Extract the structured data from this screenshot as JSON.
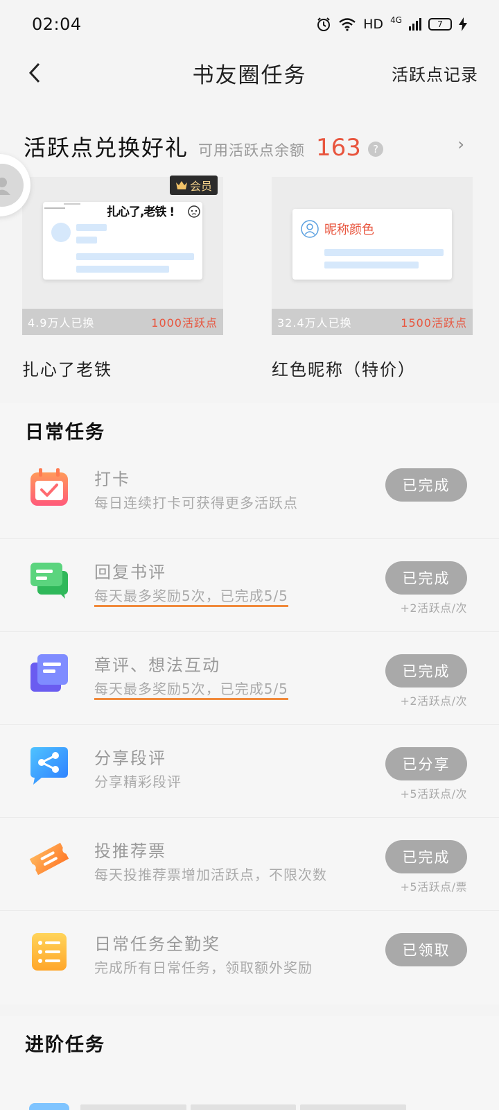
{
  "status_bar": {
    "time": "02:04",
    "hd": "HD",
    "network": "4G",
    "battery": "7"
  },
  "header": {
    "title": "书友圈任务",
    "right_link": "活跃点记录"
  },
  "exchange": {
    "title": "活跃点兑换好礼",
    "balance_label": "可用活跃点余额",
    "balance_value": "163",
    "help": "?",
    "more": "›",
    "gifts": [
      {
        "name": "扎心了老铁",
        "badge": "会员",
        "preview_text": "扎心了,老铁 !",
        "count": "4.9万人已换",
        "cost": "1000活跃点"
      },
      {
        "name": "红色昵称（特价）",
        "preview_text": "昵称颜色",
        "count": "32.4万人已换",
        "cost": "1500活跃点"
      }
    ]
  },
  "daily": {
    "title": "日常任务",
    "tasks": [
      {
        "title": "打卡",
        "desc": "每日连续打卡可获得更多活跃点",
        "button": "已完成",
        "reward": ""
      },
      {
        "title": "回复书评",
        "desc": "每天最多奖励5次，已完成5/5",
        "button": "已完成",
        "reward": "+2活跃点/次"
      },
      {
        "title": "章评、想法互动",
        "desc": "每天最多奖励5次，已完成5/5",
        "button": "已完成",
        "reward": "+2活跃点/次"
      },
      {
        "title": "分享段评",
        "desc": "分享精彩段评",
        "button": "已分享",
        "reward": "+5活跃点/次"
      },
      {
        "title": "投推荐票",
        "desc": "每天投推荐票增加活跃点，不限次数",
        "button": "已完成",
        "reward": "+5活跃点/票"
      },
      {
        "title": "日常任务全勤奖",
        "desc": "完成所有日常任务，领取额外奖励",
        "button": "已领取",
        "reward": ""
      }
    ]
  },
  "advanced": {
    "title": "进阶任务"
  },
  "colors": {
    "accent_red": "#e8553e",
    "underline_orange": "#f08a3c",
    "done_button": "#a9a9a9"
  }
}
